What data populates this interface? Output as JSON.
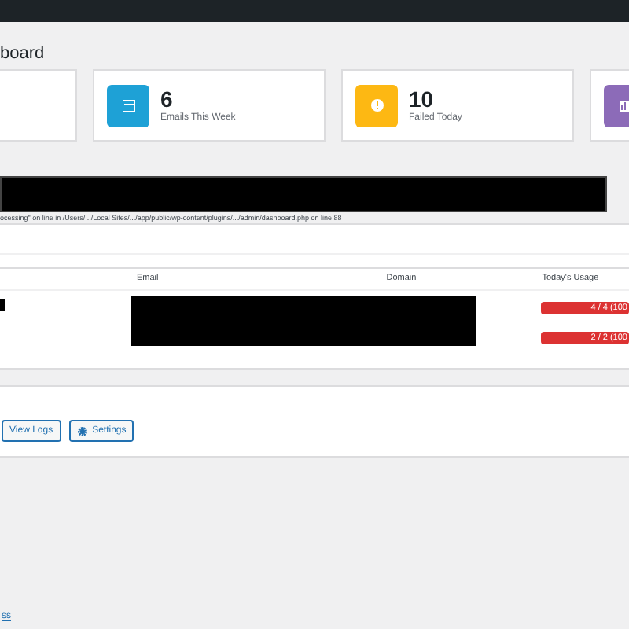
{
  "page_title": "board",
  "stat_cards": [
    {
      "kind": "empty"
    },
    {
      "kind": "calendar",
      "value": "6",
      "label": "Emails This Week"
    },
    {
      "kind": "alert",
      "value": "10",
      "label": "Failed Today"
    },
    {
      "kind": "chart"
    }
  ],
  "error_notice": {
    "message": "ocessing\" on line in /Users/.../Local Sites/.../app/public/wp-content/plugins/.../admin/dashboard.php on line 88"
  },
  "table": {
    "columns": [
      "Email",
      "Domain",
      "Today's Usage"
    ],
    "rows": [
      {
        "usage": "4 / 4 (100"
      },
      {
        "usage": "2 / 2 (100"
      }
    ]
  },
  "actions": [
    {
      "kind": "plain",
      "label": "View Logs"
    },
    {
      "kind": "gear",
      "label": "Settings"
    }
  ],
  "footer_link": "ss"
}
